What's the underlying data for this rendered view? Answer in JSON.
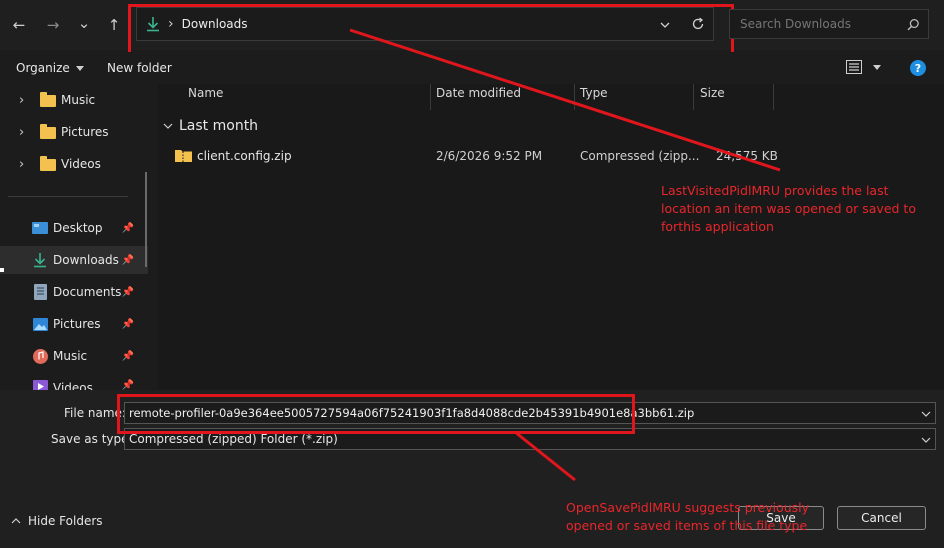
{
  "nav_buttons": {
    "back": "←",
    "forward": "→",
    "recent": "⌄",
    "up": "↑"
  },
  "address": {
    "chevron": "›",
    "location": "Downloads"
  },
  "search": {
    "placeholder": "Search Downloads"
  },
  "toolbar": {
    "organize": "Organize",
    "new_folder": "New folder"
  },
  "sidebar": {
    "tree": [
      {
        "label": "Music"
      },
      {
        "label": "Pictures"
      },
      {
        "label": "Videos"
      }
    ],
    "quick_access": [
      {
        "label": "Desktop"
      },
      {
        "label": "Downloads"
      },
      {
        "label": "Documents"
      },
      {
        "label": "Pictures"
      },
      {
        "label": "Music"
      },
      {
        "label": "Videos"
      }
    ]
  },
  "columns": {
    "name": "Name",
    "date": "Date modified",
    "type": "Type",
    "size": "Size"
  },
  "group": {
    "label": "Last month"
  },
  "files": [
    {
      "name": "client.config.zip",
      "date": "2/6/2026 9:52 PM",
      "type": "Compressed (zipp...",
      "size": "24,575 KB"
    }
  ],
  "bottom": {
    "file_name_label": "File name:",
    "file_name_value": "remote-profiler-0a9e364ee5005727594a06f75241903f1fa8d4088cde2b45391b4901e8a3bb61.zip",
    "save_type_label": "Save as type:",
    "save_type_value": "Compressed (zipped) Folder (*.zip)",
    "hide_folders": "Hide Folders",
    "save": "Save",
    "cancel": "Cancel"
  },
  "annotations": {
    "last_visited": "LastVisitedPidlMRU provides the last location an item was opened or saved to forthis application",
    "open_save": "OpenSavePidlMRU suggests previously opened or saved items of this file type"
  },
  "colors": {
    "annotation": "#e0161c",
    "accent": "#1e8fe0",
    "download": "#3ab48f"
  }
}
